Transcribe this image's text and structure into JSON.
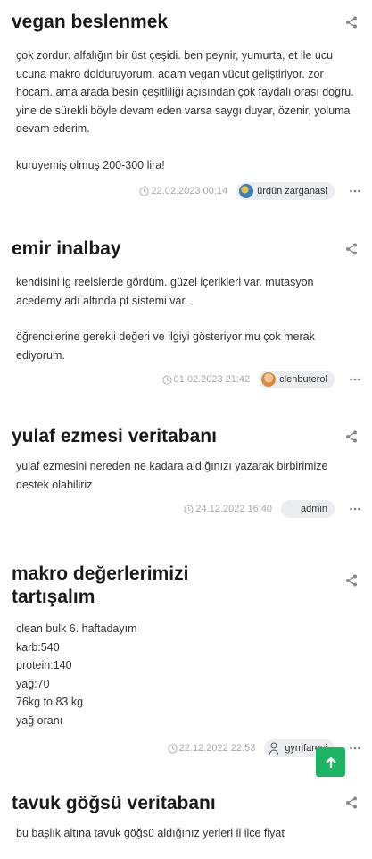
{
  "posts": [
    {
      "title": "vegan beslenmek",
      "paragraphs": [
        "çok zordur. alfalığın bir üst çeşidi. ben peynir, yumurta, et ile ucu ucuna makro dolduruyorum. adam vegan vücut geliştiriyor. zor hocam. ama arada besin çeşitliliği açısından çok faydalı orası doğru. yine de sürekli böyle devam eden varsa saygı duyar, özenir, yoluma devam ederim.",
        "kuruyemiş olmuş 200-300 lira!"
      ],
      "date": "22.02.2023 00:14",
      "author": "ürdün zarganasi",
      "avatar_color": "#3a7fb6"
    },
    {
      "title": "emir inalbay",
      "paragraphs": [
        "kendisini ig reelslerde gördüm. güzel içerikleri var. mutasyon acedemy adı altında pt sistemi var.",
        "öğrencilerine gerekli değeri ve ilgiyi gösteriyor mu çok merak ediyorum."
      ],
      "date": "01.02.2023 21:42",
      "author": "clenbuterol",
      "avatar_color": "#d98a3c"
    },
    {
      "title": "yulaf ezmesi veritabanı",
      "paragraphs": [
        "yulaf ezmesini nereden ne kadara aldığınızı yazarak birbirimize destek olabiliriz"
      ],
      "date": "24.12.2022 16:40",
      "author": "admin",
      "avatar_color": "#ecedf1"
    },
    {
      "title": "makro değerlerimizi tartışalım",
      "paragraphs": [
        "clean bulk 6. haftadayım\nkarb:540\nprotein:140\nyağ:70\n76kg to 83 kg\nyağ oranı"
      ],
      "date": "22.12.2022 22:53",
      "author": "gymfaresi",
      "avatar_color": "#555555"
    },
    {
      "title": "tavuk göğsü veritabanı",
      "paragraphs": [
        "bu başlık altına tavuk göğsü aldığınız yerleri il ilçe fiyat"
      ]
    }
  ],
  "icons": {
    "share": "share-icon",
    "clock": "clock-icon",
    "more": "more-dots-icon",
    "scroll_top": "arrow-up-icon"
  },
  "colors": {
    "accent": "#1fb464",
    "pill_bg": "#ecedf1",
    "meta_text": "#a8a8a8"
  }
}
